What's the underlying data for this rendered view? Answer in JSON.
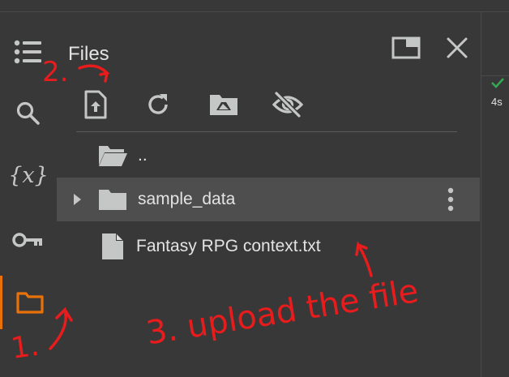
{
  "panel": {
    "title": "Files"
  },
  "toolbar": {
    "upload": "upload-to-session-storage",
    "refresh": "refresh",
    "mount_drive": "mount-drive",
    "toggle_hidden": "show-hidden-files"
  },
  "files": [
    {
      "name": "..",
      "type": "folder-open",
      "expandable": false
    },
    {
      "name": "sample_data",
      "type": "folder",
      "expandable": true
    },
    {
      "name": "Fantasy RPG context.txt",
      "type": "file",
      "expandable": false
    }
  ],
  "right": {
    "exec_time": "4s",
    "status_color": "#34a853"
  },
  "annotations": {
    "step1": "1.",
    "step2": "2.",
    "step3": "3. upload the file",
    "color": "#e81c1c"
  },
  "colors": {
    "accent": "#e8710a",
    "text": "#e3e3e3",
    "icon": "#c4c7c5"
  }
}
